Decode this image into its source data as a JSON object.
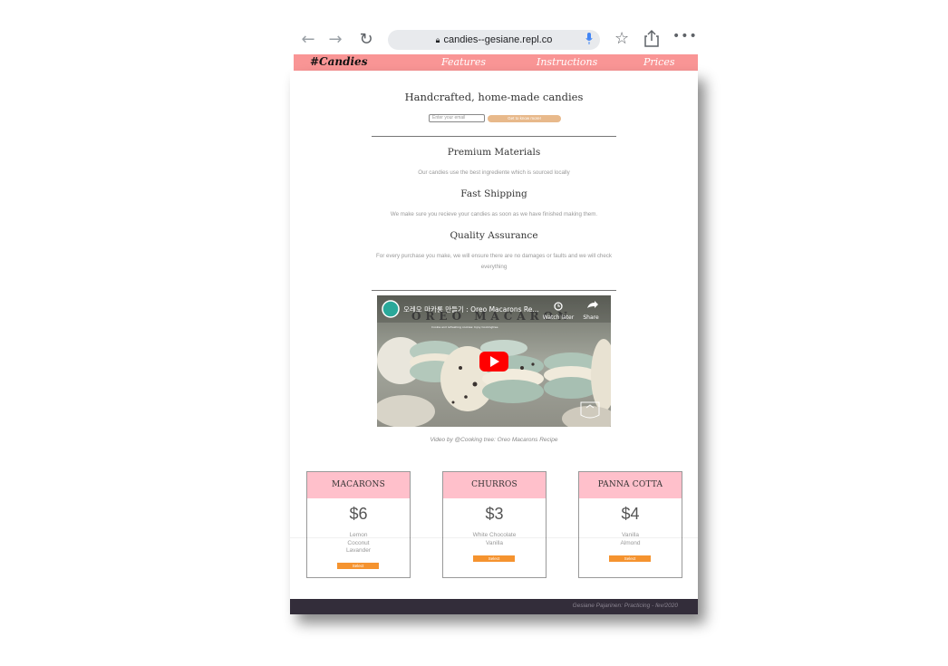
{
  "browser": {
    "url": "candies--gesiane.repl.co"
  },
  "site_nav": {
    "brand": "#Candies",
    "links": [
      "Features",
      "Instructions",
      "Prices"
    ]
  },
  "hero": {
    "title": "Handcrafted, home-made candies",
    "email_placeholder": "Enter your email",
    "cta_label": "Get to know more!"
  },
  "features": [
    {
      "title": "Premium Materials",
      "text": "Our candies use the best ingrediente which is sourced locally"
    },
    {
      "title": "Fast Shipping",
      "text": "We make sure you recieve your candies as soon as we have finished making them."
    },
    {
      "title": "Quality Assurance",
      "text": "For every purchase you make, we will ensure there are no damages or faults and we will check everything"
    }
  ],
  "video": {
    "title": "오레오 마카롱 만들기 : Oreo Macarons Re...",
    "overlay_text": "OREO MACARON",
    "subtitle": "Cookie and refreshing cookies: Injoy Cookingtree",
    "watch_later": "Watch later",
    "share": "Share",
    "caption": "Video by @Cooking tree: Oreo Macarons Recipe"
  },
  "prices": [
    {
      "name": "MACARONS",
      "price": "$6",
      "flavors": [
        "Lemon",
        "Coconut",
        "Lavander"
      ],
      "button": "Select"
    },
    {
      "name": "CHURROS",
      "price": "$3",
      "flavors": [
        "White Chocolate",
        "Vanilla"
      ],
      "button": "Select"
    },
    {
      "name": "PANNA COTTA",
      "price": "$4",
      "flavors": [
        "Vanilla",
        "Almond"
      ],
      "button": "Select"
    }
  ],
  "footer": {
    "text": "Gesiane Pajarinen: Practicing - fev/2020"
  },
  "colors": {
    "nav": "#f99595",
    "card_header": "#ffc0cb",
    "cta": "#e8b98b",
    "select": "#f5932f",
    "footer": "#332d3a"
  }
}
